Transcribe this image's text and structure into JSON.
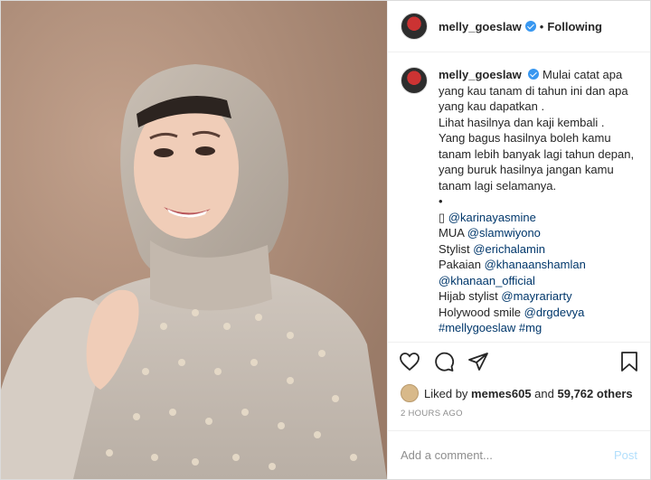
{
  "header": {
    "username": "melly_goeslaw",
    "separator": "•",
    "follow_status": "Following"
  },
  "caption": {
    "username": "melly_goeslaw",
    "text_lines": [
      "Mulai catat apa",
      "yang kau tanam di tahun ini dan apa",
      "yang kau dapatkan .",
      "Lihat hasilnya dan kaji kembali .",
      "Yang bagus hasilnya boleh kamu",
      "tanam lebih banyak lagi tahun depan,",
      "yang buruk hasilnya jangan kamu",
      "tanam lagi selamanya.",
      "•"
    ],
    "credits": [
      {
        "label": "▯",
        "handle": "@karinayasmine"
      },
      {
        "label": "MUA",
        "handle": "@slamwiyono"
      },
      {
        "label": "Stylist",
        "handle": "@erichalamin"
      },
      {
        "label": "Pakaian",
        "handle": "@khanaanshamlan"
      },
      {
        "label": "",
        "handle": "@khanaan_official"
      },
      {
        "label": "Hijab stylist",
        "handle": "@mayrariarty"
      },
      {
        "label": "Holywood smile",
        "handle": "@drgdevya"
      }
    ],
    "hashtags": [
      "#mellygoeslaw",
      "#mg"
    ],
    "time": "2h"
  },
  "likes": {
    "prefix": "Liked by",
    "user": "memes605",
    "joiner": "and",
    "others": "59,762 others"
  },
  "timestamp": "2 HOURS AGO",
  "comment_box": {
    "placeholder": "Add a comment...",
    "post_label": "Post"
  },
  "icons": {
    "verified": "verified-badge-icon",
    "like": "heart-icon",
    "comment": "comment-icon",
    "share": "paper-plane-icon",
    "save": "bookmark-icon"
  },
  "colors": {
    "link": "#00376b",
    "verified": "#3897f0",
    "muted": "#8e8e8e",
    "post_button": "#b2dffc"
  }
}
